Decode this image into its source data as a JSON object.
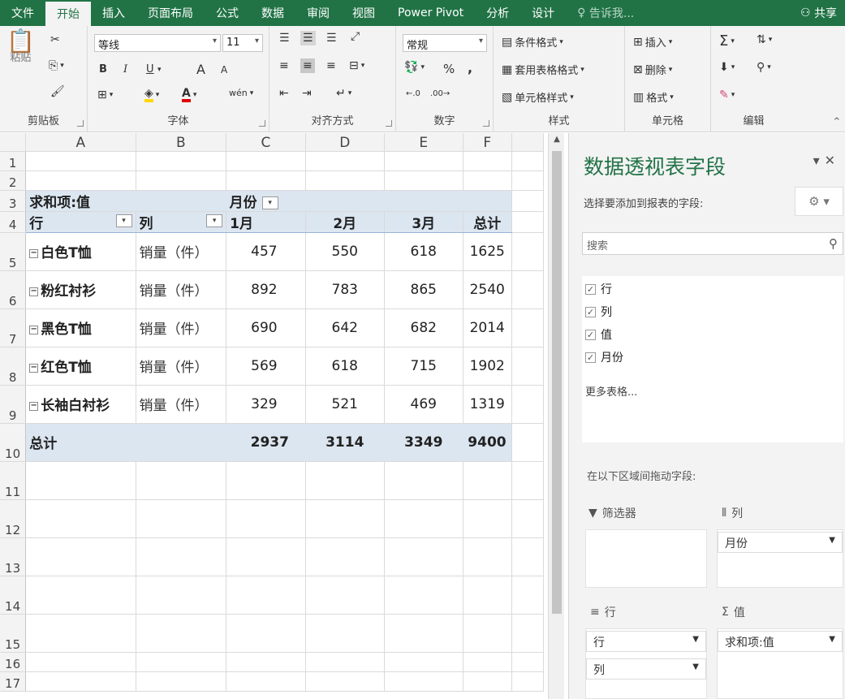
{
  "tabs": [
    "文件",
    "开始",
    "插入",
    "页面布局",
    "公式",
    "数据",
    "审阅",
    "视图",
    "Power Pivot",
    "分析",
    "设计"
  ],
  "active_tab": "开始",
  "tell_me": "告诉我...",
  "share": "共享",
  "ribbon": {
    "clipboard": {
      "label": "剪贴板",
      "paste": "粘贴"
    },
    "font": {
      "label": "字体",
      "name": "等线",
      "size": "11",
      "bold": "B",
      "italic": "I",
      "underline": "U",
      "grow": "A",
      "shrink": "A",
      "color_a": "A",
      "phonetic": "wén"
    },
    "alignment": {
      "label": "对齐方式"
    },
    "number": {
      "label": "数字",
      "format": "常规",
      "percent": "%",
      "comma": ","
    },
    "styles": {
      "label": "样式",
      "cond_format": "条件格式",
      "table_format": "套用表格格式",
      "cell_styles": "单元格样式"
    },
    "cells": {
      "label": "单元格",
      "insert": "插入",
      "delete": "删除",
      "format": "格式"
    },
    "editing": {
      "label": "编辑"
    }
  },
  "columns": [
    "A",
    "B",
    "C",
    "D",
    "E",
    "F"
  ],
  "rows": [
    "1",
    "2",
    "3",
    "4",
    "5",
    "6",
    "7",
    "8",
    "9",
    "10",
    "11",
    "12",
    "13",
    "14",
    "15",
    "16",
    "17"
  ],
  "pivot": {
    "values_label": "求和项:值",
    "col_field": "月份",
    "row_field": "行",
    "col2_field": "列",
    "months": [
      "1月",
      "2月",
      "3月",
      "总计"
    ],
    "data": [
      {
        "name": "白色T恤",
        "metric": "销量（件）",
        "values": [
          "457",
          "550",
          "618",
          "1625"
        ]
      },
      {
        "name": "粉红衬衫",
        "metric": "销量（件）",
        "values": [
          "892",
          "783",
          "865",
          "2540"
        ]
      },
      {
        "name": "黑色T恤",
        "metric": "销量（件）",
        "values": [
          "690",
          "642",
          "682",
          "2014"
        ]
      },
      {
        "name": "红色T恤",
        "metric": "销量（件）",
        "values": [
          "569",
          "618",
          "715",
          "1902"
        ]
      },
      {
        "name": "长袖白衬衫",
        "metric": "销量（件）",
        "values": [
          "329",
          "521",
          "469",
          "1319"
        ]
      }
    ],
    "total_label": "总计",
    "totals": [
      "2937",
      "3114",
      "3349",
      "9400"
    ]
  },
  "pane": {
    "title": "数据透视表字段",
    "subtitle": "选择要添加到报表的字段:",
    "search_placeholder": "搜索",
    "fields": [
      "行",
      "列",
      "值",
      "月份"
    ],
    "more_tables": "更多表格...",
    "drag_note": "在以下区域间拖动字段:",
    "zones": {
      "filters": "筛选器",
      "columns": "列",
      "rows": "行",
      "values": "值"
    },
    "column_items": [
      "月份"
    ],
    "row_items": [
      "行",
      "列"
    ],
    "value_items": [
      "求和项:值"
    ]
  },
  "colors": {
    "ribbon_green": "#217346",
    "pivot_band": "#dce6f1"
  }
}
